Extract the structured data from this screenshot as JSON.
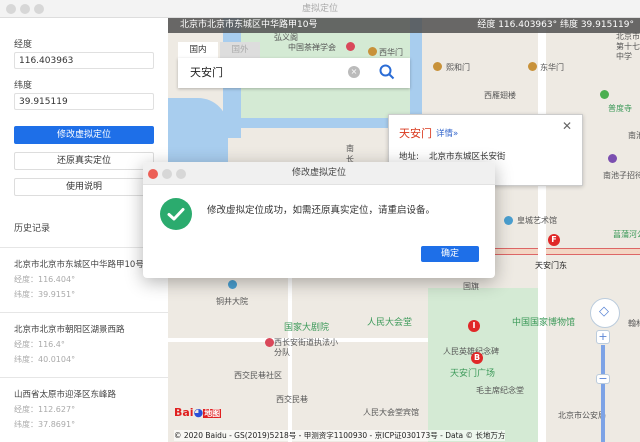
{
  "window": {
    "title": "虚拟定位"
  },
  "sidebar": {
    "longitude_label": "经度",
    "longitude_value": "116.403963",
    "latitude_label": "纬度",
    "latitude_value": "39.915119",
    "modify_button": "修改虚拟定位",
    "restore_button": "还原真实定位",
    "help_button": "使用说明",
    "history_title": "历史记录",
    "history": [
      {
        "address": "北京市北京市东城区中华路甲10号",
        "lng": "经度：116.404°",
        "lat": "纬度：39.9151°"
      },
      {
        "address": "北京市北京市朝阳区湖景西路",
        "lng": "经度：116.4°",
        "lat": "纬度：40.0104°"
      },
      {
        "address": "山西省太原市迎泽区东峰路",
        "lng": "经度：112.627°",
        "lat": "纬度：37.8691°"
      }
    ]
  },
  "map": {
    "address_bar": "北京市北京市东城区中华路甲10号",
    "coords": "经度 116.403963°   纬度 39.915119°",
    "search": {
      "tab_domestic": "国内",
      "tab_foreign": "国外",
      "query": "天安门"
    },
    "popup": {
      "title": "天安门",
      "details_link": "详情»",
      "address_label": "地址:",
      "address": "北京市东城区长安街"
    },
    "labels": [
      "中国茶禅学会",
      "西华门",
      "熙和门",
      "东华门",
      "西雁翅楼",
      "普度寺",
      "南池子招待所",
      "南池子",
      "皇城艺术馆",
      "菖蒲河公园",
      "天安门东",
      "国旗",
      "中国国家博物馆",
      "人民大会堂",
      "人民英雄纪念碑",
      "天安门广场",
      "毛主席纪念堂",
      "人民大会堂宾馆",
      "国家大剧院",
      "西长安街道执法小分队",
      "铜井大院",
      "西交民巷社区",
      "西交民巷",
      "北京市公安局",
      "翰林",
      "弘义阁",
      "北京市第十七中学",
      "南长"
    ],
    "logo": "Bai du 地图",
    "copyright": "© 2020 Baidu - GS(2019)5218号 - 甲测资字1100930 - 京ICP证030173号 - Data © 长地万方",
    "markers": [
      "F",
      "I",
      "B"
    ]
  },
  "dialog": {
    "title": "修改虚拟定位",
    "message": "修改虚拟定位成功，如需还原真实定位，请重启设备。",
    "confirm": "确定"
  },
  "colors": {
    "primary": "#1e6fe8",
    "success": "#2bab6e",
    "popup_title": "#d9371c"
  }
}
